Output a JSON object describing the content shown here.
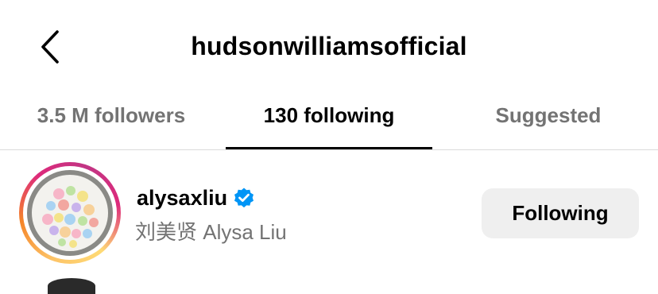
{
  "header": {
    "title": "hudsonwilliamsofficial",
    "back_icon": "chevron-left-icon"
  },
  "tabs": [
    {
      "label": "3.5 M followers",
      "active": false
    },
    {
      "label": "130 following",
      "active": true
    },
    {
      "label": "Suggested",
      "active": false
    }
  ],
  "list": [
    {
      "username": "alysaxliu",
      "verified": true,
      "full_name": "刘美贤 Alysa Liu",
      "button_label": "Following",
      "has_story_ring": true
    }
  ],
  "colors": {
    "verified_blue": "#0095f6",
    "muted_text": "#737373",
    "button_bg": "#efefef"
  }
}
